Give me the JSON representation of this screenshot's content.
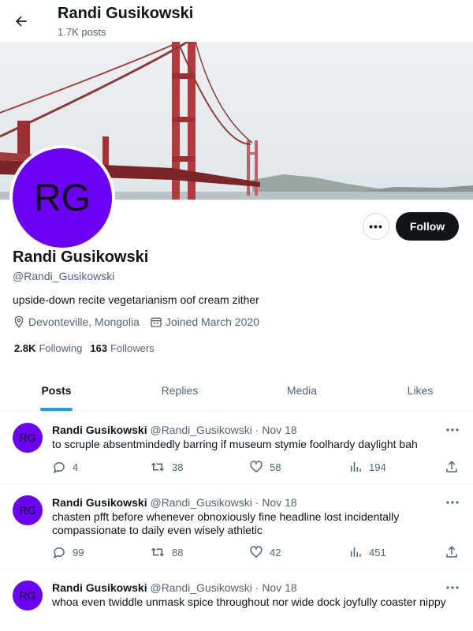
{
  "header": {
    "title": "Randi Gusikowski",
    "subtitle": "1.7K posts"
  },
  "profile": {
    "avatar_initials": "RG",
    "avatar_color": "#6a00f4",
    "name": "Randi Gusikowski",
    "handle": "@Randi_Gusikowski",
    "bio": "upside-down recite vegetarianism oof cream zither",
    "location": "Devonteville, Mongolia",
    "joined": "Joined March 2020",
    "following_count": "2.8K",
    "following_label": "Following",
    "followers_count": "163",
    "followers_label": "Followers",
    "more_label": "•••",
    "follow_label": "Follow"
  },
  "tabs": [
    {
      "label": "Posts",
      "active": true
    },
    {
      "label": "Replies"
    },
    {
      "label": "Media"
    },
    {
      "label": "Likes"
    }
  ],
  "tweets": [
    {
      "name": "Randi Gusikowski",
      "handle": "@Randi_Gusikowski",
      "sep": "·",
      "date": "Nov 18",
      "text": "to scruple absentmindedly barring if museum stymie foolhardy daylight bah",
      "replies": "4",
      "reposts": "38",
      "likes": "58",
      "views": "194"
    },
    {
      "name": "Randi Gusikowski",
      "handle": "@Randi_Gusikowski",
      "sep": "·",
      "date": "Nov 18",
      "text": "chasten pfft before whenever obnoxiously fine headline lost incidentally compassionate to daily even wisely athletic",
      "replies": "99",
      "reposts": "88",
      "likes": "42",
      "views": "451"
    },
    {
      "name": "Randi Gusikowski",
      "handle": "@Randi_Gusikowski",
      "sep": "·",
      "date": "Nov 18",
      "text": "whoa even twiddle unmask spice throughout nor wide dock joyfully coaster nippy",
      "replies": "",
      "reposts": "",
      "likes": "",
      "views": ""
    }
  ],
  "colors": {
    "accent": "#1d9bf0",
    "text": "#0f1419",
    "muted": "#536471",
    "bridge": "#c0393b"
  }
}
